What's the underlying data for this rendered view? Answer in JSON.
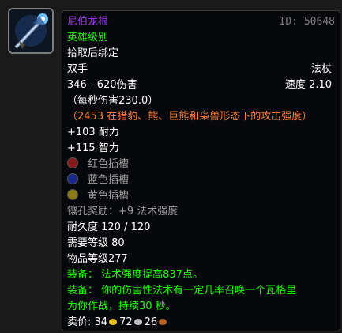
{
  "item": {
    "name": "尼伯龙根",
    "id_text": "ID: 50648",
    "quality": "英雄级别",
    "bind": "拾取后绑定",
    "slot": "双手",
    "type": "法杖",
    "damage": "346 - 620伤害",
    "speed": "速度 2.10",
    "dps": "（每秒伤害230.0）",
    "feral_ap": "（2453 在猎豹、熊、巨熊和枭兽形态下的攻击强度）",
    "stats": [
      "+103 耐力",
      "+115 智力"
    ],
    "sockets": [
      {
        "label": "红色插槽",
        "color": "#8a1a1a"
      },
      {
        "label": "蓝色插槽",
        "color": "#1a2a8a"
      },
      {
        "label": "黄色插槽",
        "color": "#8a7a1a"
      }
    ],
    "socket_bonus": "镶孔奖励：+9 法术强度",
    "durability": "耐久度 120 / 120",
    "req_level": "需要等级 80",
    "item_level": "物品等级277",
    "equip1": "装备： 法术强度提高837点。",
    "equip2_line1": "装备： 你的伤害性法术有一定几率召唤一个瓦格里",
    "equip2_line2": "为你作战，持续30 秒。",
    "sell_label": "卖价:",
    "sell_gold": "34",
    "sell_silver": "72",
    "sell_copper": "26"
  },
  "colors": {
    "epic": "#a335ee",
    "uncommon": "#1eff00",
    "feral": "#ff8040",
    "gold_coin": "#e8c21a",
    "silver_coin": "#c0c0c0",
    "copper_coin": "#b8652a"
  },
  "icon": "staff-icon"
}
